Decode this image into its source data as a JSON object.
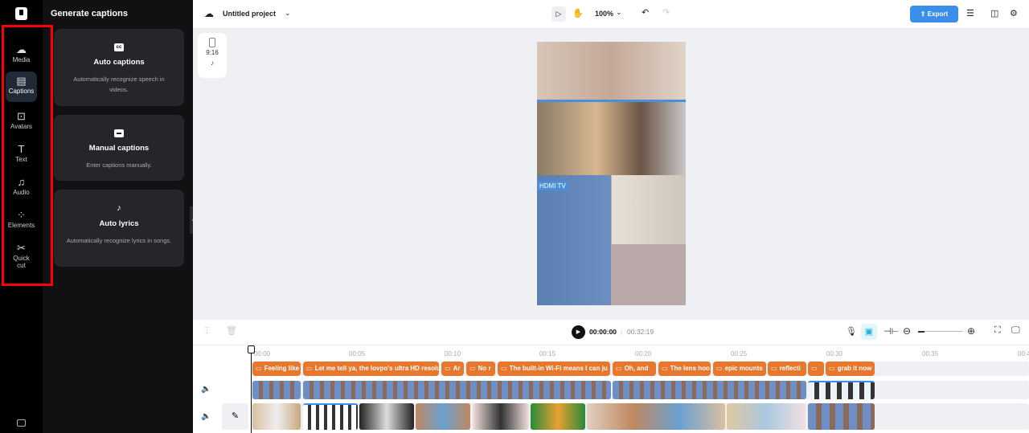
{
  "sidebar": {
    "items": [
      {
        "label": "Media",
        "icon": "cloud-upload-icon"
      },
      {
        "label": "Captions",
        "icon": "captions-icon"
      },
      {
        "label": "Avatars",
        "icon": "avatar-icon"
      },
      {
        "label": "Text",
        "icon": "text-icon"
      },
      {
        "label": "Audio",
        "icon": "music-icon"
      },
      {
        "label": "Elements",
        "icon": "elements-icon"
      },
      {
        "label": "Quick",
        "label2": "cut",
        "icon": "quick-cut-icon"
      }
    ]
  },
  "panel": {
    "title": "Generate captions",
    "cards": [
      {
        "title": "Auto captions",
        "desc": "Automatically recognize speech in videos.",
        "icon": "cc"
      },
      {
        "title": "Manual captions",
        "desc": "Enter captions manually.",
        "icon": "▬"
      },
      {
        "title": "Auto lyrics",
        "desc": "Automatically recognize lyrics in songs.",
        "icon": "♪"
      }
    ]
  },
  "topbar": {
    "project": "Untitled project",
    "zoom": "100%",
    "export": "Export"
  },
  "canvas": {
    "ratio": "9:16",
    "preview_label": "HDMI TV"
  },
  "timeline": {
    "current": "00:00:00",
    "total": "00:32:19",
    "ticks": [
      "00:00",
      "00:05",
      "00:10",
      "00:15",
      "00:20",
      "00:25",
      "00:30",
      "00:35",
      "00:4"
    ],
    "captions": [
      "Feeling like",
      "Let me tell ya, the lovpo's ultra HD resolu",
      "Ar",
      "No r",
      "The built-in Wi-Fi means I can ju",
      "Oh, and",
      "The lens hoo",
      "epic mounts",
      "reflecti",
      "",
      "grab it now"
    ]
  },
  "colors": {
    "accent": "#3b8eea",
    "caption": "#e8772e",
    "highlight": "#ff0000"
  }
}
